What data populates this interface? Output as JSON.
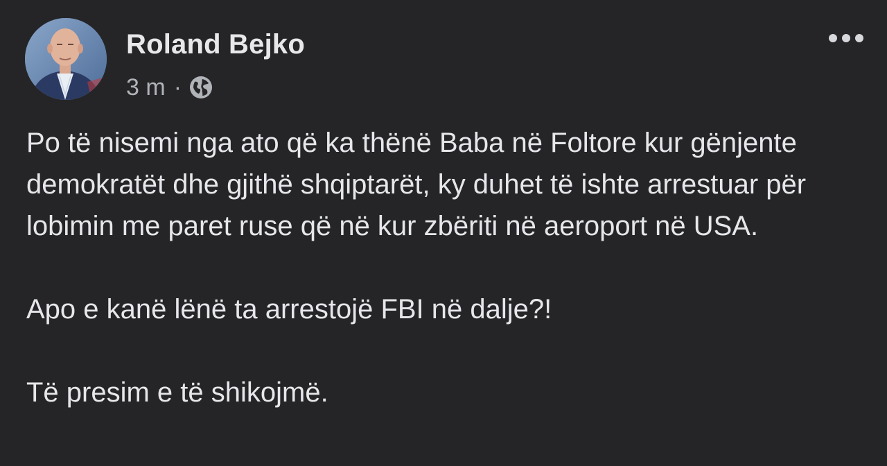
{
  "post": {
    "author": "Roland Bejko",
    "time": "3 m",
    "separator": "·",
    "audience_icon": "globe-icon",
    "more_icon": "more-options-icon",
    "paragraphs": [
      "Po të nisemi nga ato që ka thënë Baba në Foltore kur gënjente demokratët dhe gjithë shqiptarët, ky duhet të ishte arrestuar për lobimin me paret ruse që në kur zbëriti në aeroport në USA.",
      "Apo e kanë lënë ta arrestojë FBI në dalje?!",
      "Të presim e të shikojmë."
    ]
  },
  "colors": {
    "background": "#252527",
    "text": "#e6e7ea",
    "secondary_text": "#b0b3b8"
  }
}
